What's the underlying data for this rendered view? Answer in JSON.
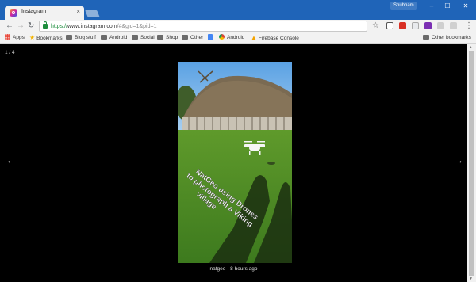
{
  "browser": {
    "tab": {
      "title": "Instagram",
      "close_glyph": "×",
      "favicon": "instagram-icon"
    },
    "profile": "Shubham",
    "window_controls": {
      "minimize": "–",
      "maximize": "☐",
      "close": "✕"
    }
  },
  "toolbar": {
    "back": "←",
    "forward": "→",
    "reload": "↻",
    "url_scheme": "https://",
    "url_host": "www.instagram.com",
    "url_path": "/#&gid=1&pid=1",
    "star": "☆",
    "menu": "⋮"
  },
  "bookmarks": [
    {
      "label": "Apps",
      "icon": "apps-icon"
    },
    {
      "label": "Bookmarks",
      "icon": "star-icon"
    },
    {
      "label": "Blog stuff",
      "icon": "folder-icon"
    },
    {
      "label": "Android",
      "icon": "folder-icon"
    },
    {
      "label": "Social",
      "icon": "folder-icon"
    },
    {
      "label": "Shop",
      "icon": "folder-icon"
    },
    {
      "label": "Other",
      "icon": "folder-icon"
    },
    {
      "label": "",
      "icon": "docs-icon"
    },
    {
      "label": "Android",
      "icon": "chrome-icon"
    },
    {
      "label": "Firebase Console",
      "icon": "firebase-icon"
    },
    {
      "label": "Other bookmarks",
      "icon": "folder-icon"
    }
  ],
  "viewer": {
    "counter": "1 / 4",
    "prev": "←",
    "next": "→",
    "photo_text": [
      "NatGeo using Drones",
      "to photograph a Viking",
      "village"
    ],
    "caption": "natgeo - 8 hours ago"
  },
  "colors": {
    "titlebar": "#1f64b8",
    "toolbar": "#f2f2f2",
    "viewer_bg": "#000000",
    "url_secure": "#1e8e3e"
  }
}
